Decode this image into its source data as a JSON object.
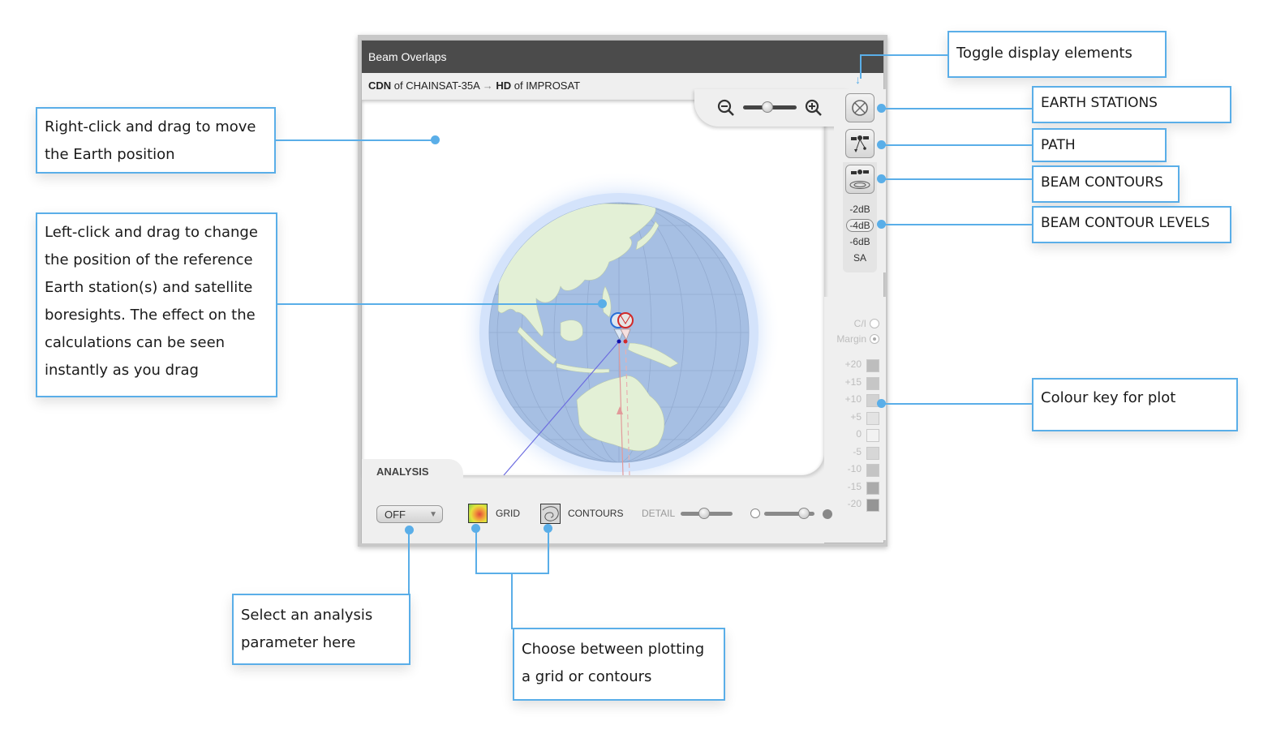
{
  "window": {
    "title": "Beam Overlaps",
    "subtitle": {
      "source_beam": "CDN",
      "source_of": "of",
      "source_satellite": "CHAINSAT-35A",
      "arrow": "→",
      "target_beam": "HD",
      "target_of": "of",
      "target_satellite": "IMPROSAT"
    },
    "zoom": {
      "out_icon": "zoom-out-icon",
      "in_icon": "zoom-in-icon",
      "level_fraction": 0.5
    },
    "toggles": [
      {
        "name": "earth-stations",
        "icon": "earth-station-icon"
      },
      {
        "name": "path",
        "icon": "path-icon"
      },
      {
        "name": "beam-contours",
        "icon": "beam-contour-icon"
      }
    ],
    "contour_levels": [
      "-2dB",
      "-4dB",
      "-6dB",
      "SA"
    ],
    "contour_level_selected": "-4dB",
    "mode_options": [
      {
        "label": "C/I",
        "selected": false
      },
      {
        "label": "Margin",
        "selected": true
      }
    ],
    "colour_key": [
      {
        "label": "+20",
        "color": "#bdbdbd"
      },
      {
        "label": "+15",
        "color": "#c6c6c6"
      },
      {
        "label": "+10",
        "color": "#d2d2d2"
      },
      {
        "label": "+5",
        "color": "#e3e3e3"
      },
      {
        "label": "0",
        "color": "#f2f2f2"
      },
      {
        "label": "-5",
        "color": "#d7d7d7"
      },
      {
        "label": "-10",
        "color": "#c4c4c4"
      },
      {
        "label": "-15",
        "color": "#ababab"
      },
      {
        "label": "-20",
        "color": "#959595"
      }
    ],
    "analysis": {
      "tab_label": "ANALYSIS",
      "parameter_value": "OFF",
      "grid_label": "GRID",
      "contours_label": "CONTOURS",
      "detail_label": "DETAIL",
      "detail_fraction": 0.45,
      "opacity_fraction": 0.8
    },
    "colors": {
      "titlebar": "#4b4b4b",
      "ocean": "#a6bfe3",
      "land": "#e3f0d6",
      "station_a": "#2a6fd6",
      "station_b": "#d12a2a"
    }
  },
  "callouts": {
    "move_earth": "Right-click and drag to move the Earth position",
    "drag_station": "Left-click and drag to change the position of the reference Earth station(s) and satellite boresights. The effect on the calculations can be seen instantly as you drag",
    "toggle_display": "Toggle display elements",
    "earth_stations": "EARTH STATIONS",
    "path": "PATH",
    "beam_contours": "BEAM CONTOURS",
    "beam_contour_levels": "BEAM CONTOUR LEVELS",
    "colour_key": "Colour key for plot",
    "select_parameter": "Select an analysis parameter here",
    "grid_or_contours": "Choose between plotting a grid or contours"
  }
}
